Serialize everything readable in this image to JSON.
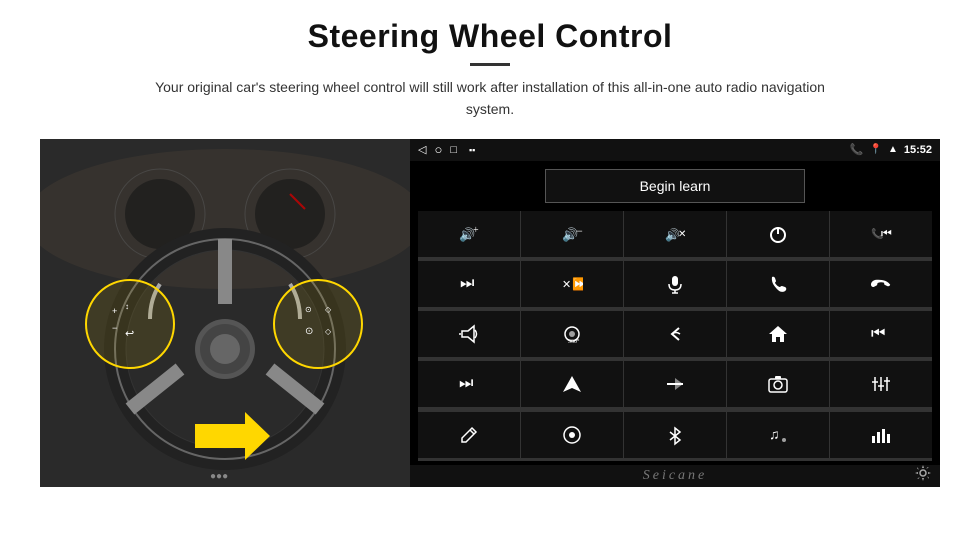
{
  "header": {
    "title": "Steering Wheel Control",
    "subtitle": "Your original car's steering wheel control will still work after installation of this all-in-one auto radio navigation system."
  },
  "status_bar": {
    "time": "15:52",
    "nav_back": "◁",
    "nav_home": "○",
    "nav_rect": "□",
    "battery_signal": "▪▪"
  },
  "begin_learn": {
    "label": "Begin learn"
  },
  "controls": [
    {
      "icon": "🔊+",
      "name": "vol-up"
    },
    {
      "icon": "🔊−",
      "name": "vol-down"
    },
    {
      "icon": "🔇",
      "name": "mute"
    },
    {
      "icon": "⏻",
      "name": "power"
    },
    {
      "icon": "⏮",
      "name": "prev-track-phone"
    },
    {
      "icon": "⏭",
      "name": "next-track"
    },
    {
      "icon": "⏩",
      "name": "fast-forward"
    },
    {
      "icon": "🎤",
      "name": "mic"
    },
    {
      "icon": "📞",
      "name": "phone"
    },
    {
      "icon": "📵",
      "name": "hang-up"
    },
    {
      "icon": "📢",
      "name": "horn"
    },
    {
      "icon": "⟳",
      "name": "360-view"
    },
    {
      "icon": "↩",
      "name": "back"
    },
    {
      "icon": "⌂",
      "name": "home"
    },
    {
      "icon": "⏮⏮",
      "name": "rewind"
    },
    {
      "icon": "⏭⏭",
      "name": "skip-forward"
    },
    {
      "icon": "▶",
      "name": "navigate"
    },
    {
      "icon": "⇌",
      "name": "swap"
    },
    {
      "icon": "📷",
      "name": "camera"
    },
    {
      "icon": "⚙",
      "name": "eq"
    },
    {
      "icon": "✏",
      "name": "edit"
    },
    {
      "icon": "⊙",
      "name": "circle-btn"
    },
    {
      "icon": "✦",
      "name": "bluetooth"
    },
    {
      "icon": "♫",
      "name": "music"
    },
    {
      "icon": "⣿",
      "name": "spectrum"
    }
  ],
  "seicane": {
    "label": "Seicane"
  },
  "colors": {
    "background": "#ffffff",
    "android_bg": "#000000",
    "android_cell": "#111111",
    "title_color": "#111111",
    "circle_color": "#FFD700"
  }
}
